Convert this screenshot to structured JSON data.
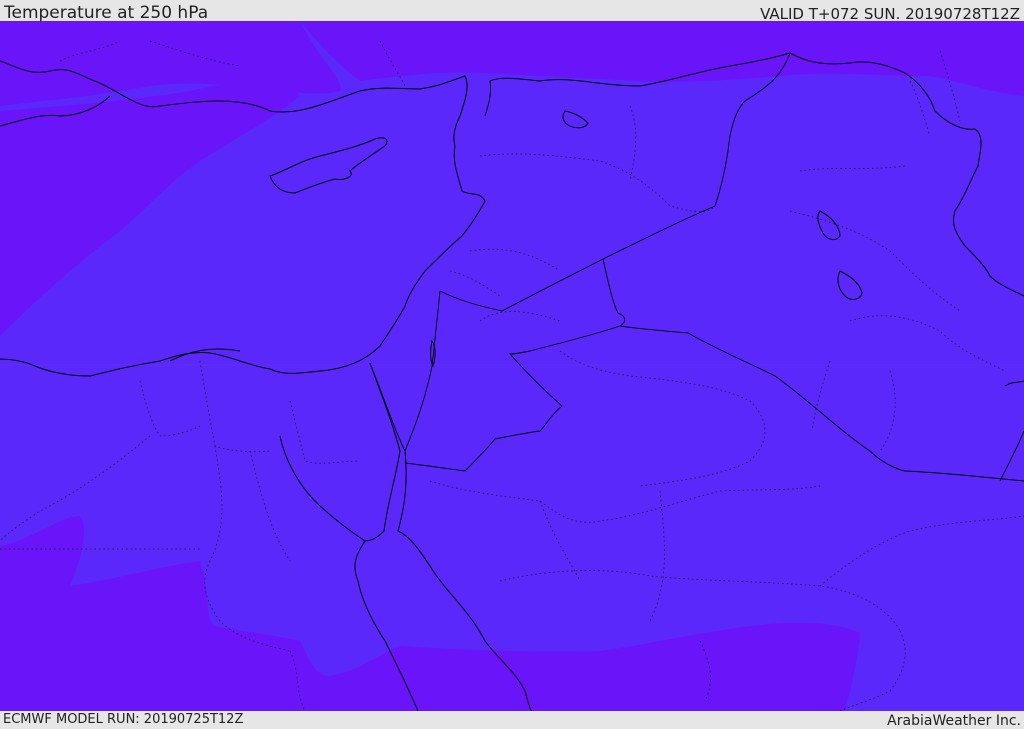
{
  "header": {
    "title": "Temperature at 250 hPa",
    "valid_time": "VALID T+072 SUN. 20190728T12Z"
  },
  "footer": {
    "model_run": "ECMWF MODEL RUN: 20190725T12Z",
    "brand": "ArabiaWeather Inc."
  },
  "colors": {
    "field_primary": "#5a28fb",
    "field_secondary": "#6a14fa",
    "coastline": "#000000",
    "border_dotted": "#1a1a1a",
    "bar_background": "#e6e6e6"
  }
}
